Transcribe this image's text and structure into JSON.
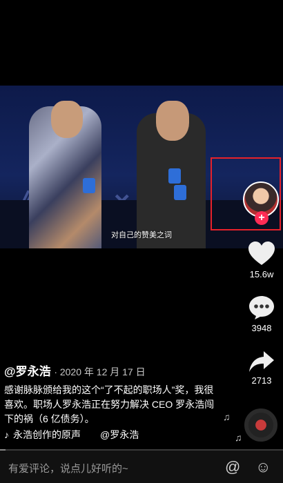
{
  "video": {
    "subtitle": "对自己的赞美之词"
  },
  "actions": {
    "likes": "15.6w",
    "comments": "3948",
    "shares": "2713"
  },
  "post": {
    "author": "@罗永浩",
    "date": "· 2020 年 12 月 17 日",
    "caption": "感谢脉脉颁给我的这个“了不起的职场人”奖，我很喜欢。职场人罗永浩正在努力解决 CEO 罗永浩闯下的祸（6 亿债务）。",
    "music": "永浩创作的原声　　@罗永浩"
  },
  "playback": {
    "progress_fraction": 0.02
  },
  "comment_bar": {
    "placeholder": "有爱评论，说点儿好听的~"
  },
  "icons": {
    "like": "heart-icon",
    "comment": "comment-icon",
    "share": "share-icon",
    "music": "music-note-icon",
    "mention": "at-icon",
    "emoji": "emoji-icon"
  },
  "colors": {
    "follow_plus": "#fe2c55",
    "highlight_box": "#e8212a"
  }
}
